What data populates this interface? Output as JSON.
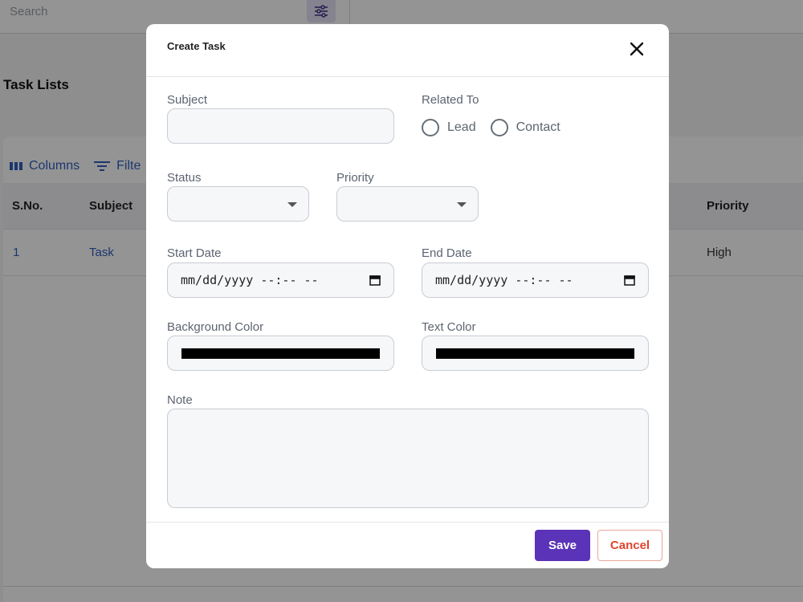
{
  "background": {
    "search_placeholder": "Search",
    "page_title": "Task Lists",
    "toolbar": {
      "columns_label": "Columns",
      "filters_label": "Filte"
    },
    "table": {
      "headers": [
        "S.No.",
        "Subject",
        "Priority"
      ],
      "rows": [
        {
          "sno": "1",
          "subject": "Task",
          "priority": "High"
        }
      ]
    }
  },
  "modal": {
    "title": "Create Task",
    "fields": {
      "subject": {
        "label": "Subject",
        "value": ""
      },
      "related_to": {
        "label": "Related To",
        "options": [
          "Lead",
          "Contact"
        ]
      },
      "status": {
        "label": "Status",
        "value": ""
      },
      "priority": {
        "label": "Priority",
        "value": ""
      },
      "start_date": {
        "label": "Start Date",
        "value": "mm/dd/yyyy --:-- --"
      },
      "end_date": {
        "label": "End Date",
        "value": "mm/dd/yyyy --:-- --"
      },
      "background_color": {
        "label": "Background Color",
        "value": "#000000"
      },
      "text_color": {
        "label": "Text Color",
        "value": "#000000"
      },
      "note": {
        "label": "Note",
        "value": ""
      }
    },
    "buttons": {
      "save": "Save",
      "cancel": "Cancel"
    }
  },
  "colors": {
    "accent": "#5b33b8",
    "cancel": "#e2442f",
    "link": "#2f5fbf"
  }
}
